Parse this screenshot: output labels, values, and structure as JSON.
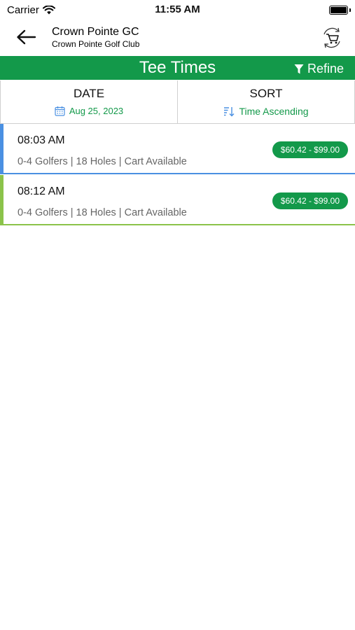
{
  "status_bar": {
    "carrier": "Carrier",
    "time": "11:55 AM"
  },
  "header": {
    "back_icon": "arrow-left-icon",
    "title": "Crown Pointe GC",
    "subtitle": "Crown Pointe Golf Club",
    "cart_icon": "cart-refresh-icon"
  },
  "title_bar": {
    "title": "Tee Times",
    "refine_label": "Refine",
    "refine_icon": "filter-icon"
  },
  "filters": {
    "date_label": "DATE",
    "date_value": "Aug 25, 2023",
    "date_icon": "calendar-icon",
    "sort_label": "SORT",
    "sort_value": "Time Ascending",
    "sort_icon": "sort-descending-icon"
  },
  "tee_times": [
    {
      "time": "08:03 AM",
      "details": "0-4 Golfers | 18 Holes  | Cart Available",
      "price": "$60.42 - $99.00",
      "accent": "#4a90e2"
    },
    {
      "time": "08:12 AM",
      "details": "0-4 Golfers | 18 Holes  | Cart Available",
      "price": "$60.42 - $99.00",
      "accent": "#8bc34a"
    }
  ],
  "colors": {
    "brand_green": "#13994a",
    "row1_accent": "#4a90e2",
    "row2_accent": "#8bc34a"
  }
}
